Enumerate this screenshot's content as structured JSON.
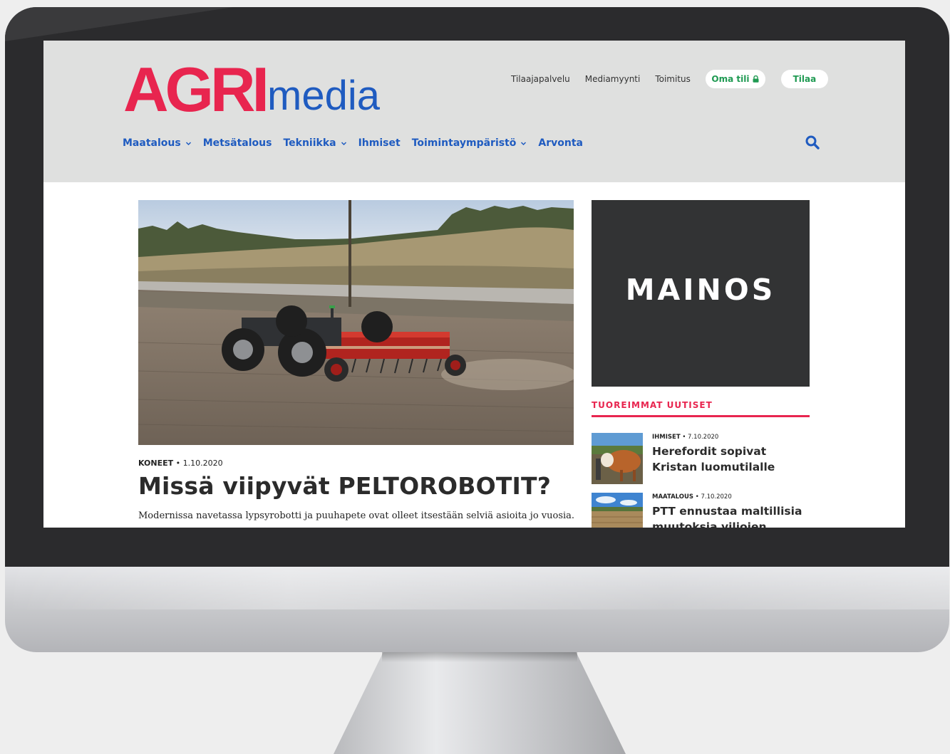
{
  "brand": {
    "logo_primary": "AGRI",
    "logo_secondary": "media",
    "primary_color": "#e8254f",
    "secondary_color": "#1f5bc0"
  },
  "top_links": {
    "subscriber_service": "Tilaajapalvelu",
    "media_sales": "Mediamyynti",
    "editorial": "Toimitus",
    "account_button": "Oma tili",
    "subscribe_button": "Tilaa"
  },
  "nav": {
    "items": [
      {
        "label": "Maatalous",
        "has_dropdown": true
      },
      {
        "label": "Metsätalous",
        "has_dropdown": false
      },
      {
        "label": "Tekniikka",
        "has_dropdown": true
      },
      {
        "label": "Ihmiset",
        "has_dropdown": false
      },
      {
        "label": "Toimintaympäristö",
        "has_dropdown": true
      },
      {
        "label": "Arvonta",
        "has_dropdown": false
      }
    ],
    "search_icon": "search-icon"
  },
  "article": {
    "category": "KONEET",
    "separator": "•",
    "date": "1.10.2020",
    "title": "Missä viipyvät PELTOROBOTIT?",
    "lead": "Modernissa navetassa lypsyrobotti ja puuhapete ovat olleet itsestään selviä asioita jo vuosia."
  },
  "sidebar": {
    "ad_label": "MAINOS",
    "news_heading": "TUOREIMMAT UUTISET",
    "news": [
      {
        "category": "IHMISET",
        "separator": "•",
        "date": "7.10.2020",
        "title": "Herefordit sopivat Kristan luomutilalle"
      },
      {
        "category": "MAATALOUS",
        "separator": "•",
        "date": "7.10.2020",
        "title": "PTT ennustaa maltillisia muutoksia viljojen"
      }
    ]
  }
}
